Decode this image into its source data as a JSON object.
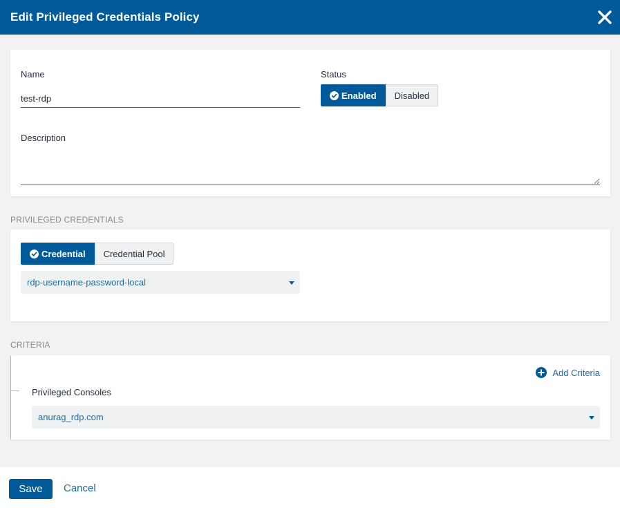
{
  "dialog": {
    "title": "Edit Privileged Credentials Policy"
  },
  "general": {
    "name_label": "Name",
    "name_value": "test-rdp",
    "status_label": "Status",
    "status_options": [
      "Enabled",
      "Disabled"
    ],
    "status_selected": "Enabled",
    "description_label": "Description",
    "description_value": ""
  },
  "privileged_credentials": {
    "section_title": "PRIVILEGED CREDENTIALS",
    "type_options": [
      "Credential",
      "Credential Pool"
    ],
    "type_selected": "Credential",
    "credential_value": "rdp-username-password-local"
  },
  "criteria": {
    "section_title": "CRITERIA",
    "add_label": "Add Criteria",
    "consoles_label": "Privileged Consoles",
    "consoles_value": "anurag_rdp.com"
  },
  "footer": {
    "save_label": "Save",
    "cancel_label": "Cancel"
  },
  "colors": {
    "primary": "#005a9a",
    "link": "#1f6b9c",
    "background": "#f2f2f2"
  }
}
